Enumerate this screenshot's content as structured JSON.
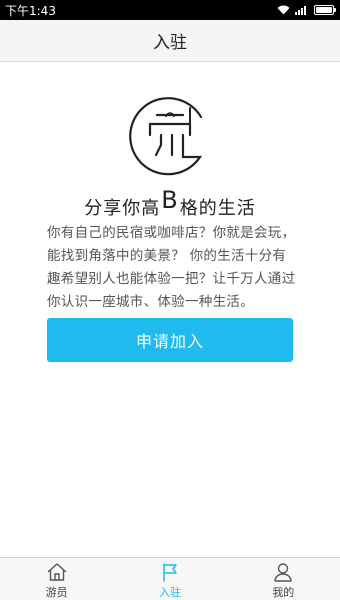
{
  "status_bar": {
    "time": "下午1:43"
  },
  "header": {
    "title": "入驻"
  },
  "main": {
    "headline_prefix": "分享你高",
    "headline_big": "B",
    "headline_suffix": "格的生活",
    "intro": "你有自己的民宿或咖啡店？你就是会玩，能找到角落中的美景？ 你的生活十分有趣希望别人也能体验一把？让千万人通过你认识一座城市、体验一种生活。",
    "apply_label": "申请加入"
  },
  "tab_bar": {
    "items": [
      {
        "label": "游员",
        "icon": "home-icon",
        "active": false
      },
      {
        "label": "入驻",
        "icon": "flag-icon",
        "active": true
      },
      {
        "label": "我的",
        "icon": "user-icon",
        "active": false
      }
    ]
  },
  "colors": {
    "accent": "#1fbbef",
    "status_bar_bg": "#000000",
    "header_bg": "#f5f5f5"
  }
}
